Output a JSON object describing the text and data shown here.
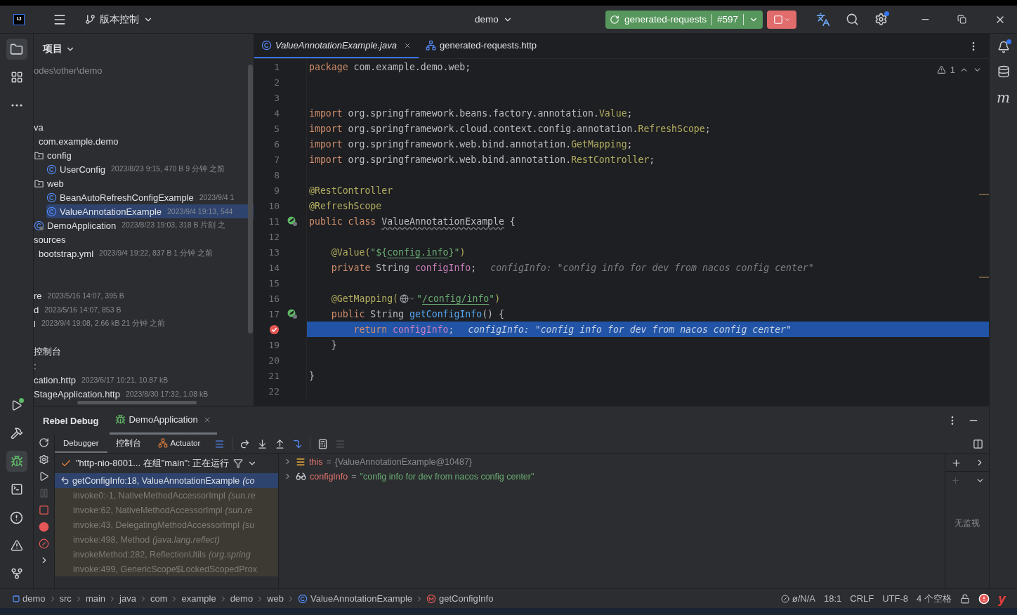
{
  "title_bar": {
    "logo": "IJ",
    "vcs": "版本控制",
    "project": "demo",
    "run_config": "generated-requests",
    "run_number": "#597"
  },
  "tool_strip": [
    {
      "kind": "folder",
      "selected": true
    },
    {
      "kind": "structure",
      "selected": false
    },
    {
      "kind": "more",
      "selected": false
    }
  ],
  "tool_strip_bottom": [
    {
      "kind": "run",
      "selected": false
    },
    {
      "kind": "build",
      "selected": false
    },
    {
      "kind": "debug",
      "selected": true
    },
    {
      "kind": "terminal",
      "selected": false
    },
    {
      "kind": "problems",
      "selected": false
    },
    {
      "kind": "warnings",
      "selected": false
    },
    {
      "kind": "git",
      "selected": false
    }
  ],
  "right_strip": {
    "maven_label": "m"
  },
  "project_panel": {
    "title": "项目",
    "path": "odes\\other\\demo",
    "sections": [
      {
        "nodes": [
          {
            "name": "va",
            "kind": "plain",
            "selected": false,
            "children": [
              {
                "name": "com.example.demo",
                "kind": "plain",
                "selected": false,
                "children": [
                  {
                    "name": "config",
                    "kind": "folder",
                    "selected": false,
                    "children": [
                      {
                        "name": "UserConfig",
                        "meta": "2023/8/23 9:15, 470 B 9 分钟 之前",
                        "kind": "class",
                        "selected": false
                      }
                    ]
                  },
                  {
                    "name": "web",
                    "kind": "folder",
                    "selected": false,
                    "children": [
                      {
                        "name": "BeanAutoRefreshConfigExample",
                        "meta": "2023/9/4 1",
                        "kind": "class",
                        "selected": false
                      },
                      {
                        "name": "ValueAnnotationExample",
                        "meta": "2023/9/4 19:13, 544",
                        "kind": "class",
                        "selected": true
                      }
                    ]
                  },
                  {
                    "name": "DemoApplication",
                    "meta": "2023/8/23 19:03, 318 B 片刻 之",
                    "kind": "app",
                    "selected": false
                  }
                ]
              }
            ]
          },
          {
            "name": "sources",
            "kind": "plain",
            "selected": false,
            "children": [
              {
                "name": "bootstrap.yml",
                "meta": "2023/9/4 19:22, 837 B 1 分钟 之前",
                "kind": "plain",
                "selected": false
              }
            ]
          }
        ]
      },
      {
        "nodes": [
          {
            "name": "re",
            "meta": "2023/5/16 14:07, 395 B",
            "kind": "plain",
            "selected": false
          },
          {
            "name": "d",
            "meta": "2023/5/16 14:07, 853 B",
            "kind": "plain",
            "selected": false
          },
          {
            "name": "l",
            "meta": "2023/9/4 19:08, 2.66 kB 21 分钟 之前",
            "kind": "plain",
            "selected": false
          }
        ]
      },
      {
        "nodes": [
          {
            "name": "控制台",
            "kind": "plain",
            "selected": false
          },
          {
            "name": ":",
            "kind": "plain",
            "selected": false
          },
          {
            "name": "cation.http",
            "meta": "2023/6/17 10:21, 10.87 kB",
            "kind": "plain",
            "selected": false
          },
          {
            "name": "StageApplication.http",
            "meta": "2023/8/30 17:32, 1.08 kB",
            "kind": "plain",
            "selected": false
          }
        ]
      }
    ]
  },
  "editor": {
    "tabs": [
      {
        "label": "ValueAnnotationExample.java",
        "kind": "class",
        "selected": true,
        "closable": true
      },
      {
        "label": "generated-requests.http",
        "kind": "http",
        "selected": false,
        "closable": false
      }
    ],
    "warning_count": "1",
    "lines": [
      {
        "number": "1",
        "bean": false,
        "breakpoint": false,
        "current": false,
        "segments": [
          {
            "kind": "keyword",
            "text": "package"
          },
          {
            "kind": "plain",
            "text": " com.example.demo.web;"
          }
        ]
      },
      {
        "number": "2",
        "bean": false,
        "breakpoint": false,
        "current": false
      },
      {
        "number": "3",
        "bean": false,
        "breakpoint": false,
        "current": false
      },
      {
        "number": "4",
        "bean": false,
        "breakpoint": false,
        "current": false,
        "segments": [
          {
            "kind": "keyword",
            "text": "import"
          },
          {
            "kind": "plain",
            "text": " org.springframework.beans.factory.annotation."
          },
          {
            "kind": "annotation",
            "text": "Value"
          },
          {
            "kind": "plain",
            "text": ";"
          }
        ]
      },
      {
        "number": "5",
        "bean": false,
        "breakpoint": false,
        "current": false,
        "segments": [
          {
            "kind": "keyword",
            "text": "import"
          },
          {
            "kind": "plain",
            "text": " org.springframework.cloud.context.config.annotation."
          },
          {
            "kind": "annotation",
            "text": "RefreshScope"
          },
          {
            "kind": "plain",
            "text": ";"
          }
        ]
      },
      {
        "number": "6",
        "bean": false,
        "breakpoint": false,
        "current": false,
        "segments": [
          {
            "kind": "keyword",
            "text": "import"
          },
          {
            "kind": "plain",
            "text": " org.springframework.web.bind.annotation."
          },
          {
            "kind": "annotation",
            "text": "GetMapping"
          },
          {
            "kind": "plain",
            "text": ";"
          }
        ]
      },
      {
        "number": "7",
        "bean": false,
        "breakpoint": false,
        "current": false,
        "segments": [
          {
            "kind": "keyword",
            "text": "import"
          },
          {
            "kind": "plain",
            "text": " org.springframework.web.bind.annotation."
          },
          {
            "kind": "annotation",
            "text": "RestController"
          },
          {
            "kind": "plain",
            "text": ";"
          }
        ]
      },
      {
        "number": "8",
        "bean": false,
        "breakpoint": false,
        "current": false
      },
      {
        "number": "9",
        "bean": false,
        "breakpoint": false,
        "current": false,
        "segments": [
          {
            "kind": "annotation",
            "text": "@RestController"
          }
        ]
      },
      {
        "number": "10",
        "bean": false,
        "breakpoint": false,
        "current": false,
        "segments": [
          {
            "kind": "annotation",
            "text": "@RefreshScope"
          }
        ]
      },
      {
        "number": "11",
        "bean": true,
        "breakpoint": false,
        "current": false,
        "segments": [
          {
            "kind": "keyword",
            "text": "public class "
          },
          {
            "kind": "wavy",
            "text": "ValueAnnotationExample"
          },
          {
            "kind": "plain",
            "text": " {"
          }
        ]
      },
      {
        "number": "12",
        "bean": false,
        "breakpoint": false,
        "current": false
      },
      {
        "number": "13",
        "bean": false,
        "breakpoint": false,
        "current": false,
        "segments": [
          {
            "kind": "annotation",
            "text": "    @Value("
          },
          {
            "kind": "string",
            "text": "\"${"
          },
          {
            "kind": "link",
            "text": "config.info"
          },
          {
            "kind": "string",
            "text": "}\""
          },
          {
            "kind": "annotation",
            "text": ")"
          }
        ]
      },
      {
        "number": "14",
        "bean": false,
        "breakpoint": false,
        "current": false,
        "segments": [
          {
            "kind": "keyword",
            "text": "    private"
          },
          {
            "kind": "plain",
            "text": " String "
          },
          {
            "kind": "field",
            "text": "configInfo"
          },
          {
            "kind": "plain",
            "text": ";"
          },
          {
            "kind": "hint",
            "text": "configInfo: \"config info for dev from nacos config center\""
          }
        ]
      },
      {
        "number": "15",
        "bean": false,
        "breakpoint": false,
        "current": false
      },
      {
        "number": "16",
        "bean": false,
        "breakpoint": false,
        "current": false,
        "segments": [
          {
            "kind": "annotation",
            "text": "    @GetMapping("
          },
          {
            "kind": "globe"
          },
          {
            "kind": "string",
            "text": "\""
          },
          {
            "kind": "link",
            "text": "/config/info"
          },
          {
            "kind": "string",
            "text": "\""
          },
          {
            "kind": "annotation",
            "text": ")"
          }
        ]
      },
      {
        "number": "17",
        "bean": true,
        "breakpoint": false,
        "current": false,
        "segments": [
          {
            "kind": "keyword",
            "text": "    public"
          },
          {
            "kind": "plain",
            "text": " String "
          },
          {
            "kind": "method",
            "text": "getConfigInfo"
          },
          {
            "kind": "plain",
            "text": "() {"
          }
        ]
      },
      {
        "bean": false,
        "breakpoint": true,
        "current": true,
        "segments": [
          {
            "kind": "keyword",
            "text": "        return "
          },
          {
            "kind": "field",
            "text": "configInfo"
          },
          {
            "kind": "plain",
            "text": ";"
          },
          {
            "kind": "hint",
            "text": "configInfo: \"config info for dev from nacos config center\""
          }
        ]
      },
      {
        "number": "19",
        "bean": false,
        "breakpoint": false,
        "current": false,
        "segments": [
          {
            "kind": "plain",
            "text": "    }"
          }
        ]
      },
      {
        "number": "20",
        "bean": false,
        "breakpoint": false,
        "current": false
      },
      {
        "number": "21",
        "bean": false,
        "breakpoint": false,
        "current": false,
        "segments": [
          {
            "kind": "plain",
            "text": "}"
          }
        ]
      },
      {
        "number": "22",
        "bean": false,
        "breakpoint": false,
        "current": false
      }
    ]
  },
  "debug_panel": {
    "title": "Rebel Debug",
    "session_tab": {
      "label": "DemoApplication",
      "selected": true
    },
    "tabs": [
      {
        "label": "Debugger",
        "kind": "plain",
        "selected": true
      },
      {
        "label": "控制台",
        "kind": "plain",
        "selected": false
      },
      {
        "label": "Actuator",
        "kind": "actuator",
        "selected": false
      }
    ],
    "thread": "\"http-nio-8001... 在组\"main\": 正在运行",
    "frames": [
      {
        "method": "getConfigInfo:18, ValueAnnotationExample",
        "package": "(co",
        "library": false,
        "selected": true
      },
      {
        "method": "invoke0:-1, NativeMethodAccessorImpl",
        "package": "(sun.re",
        "library": true,
        "selected": false
      },
      {
        "method": "invoke:62, NativeMethodAccessorImpl",
        "package": "(sun.re",
        "library": true,
        "selected": false
      },
      {
        "method": "invoke:43, DelegatingMethodAccessorImpl",
        "package": "(su",
        "library": true,
        "selected": false
      },
      {
        "method": "invoke:498, Method",
        "package": "(java.lang.reflect)",
        "library": true,
        "selected": false
      },
      {
        "method": "invokeMethod:282, ReflectionUtils",
        "package": "(org.spring",
        "library": true,
        "selected": false
      },
      {
        "method": "invoke:499, GenericScope$LockedScopedProx",
        "library": true,
        "selected": false
      }
    ],
    "variables": [
      {
        "kind": "object",
        "name": "this",
        "sign": "=",
        "value": "{ValueAnnotationExample@10487}"
      },
      {
        "kind": "watch",
        "name": "configInfo",
        "sign": "=",
        "value": "\"config info for dev from nacos config center\""
      }
    ],
    "watches_empty": "无监视"
  },
  "status_bar": {
    "breadcrumbs": [
      {
        "kind": "module",
        "text": "demo"
      },
      {
        "kind": "plain",
        "text": "src"
      },
      {
        "kind": "plain",
        "text": "main"
      },
      {
        "kind": "plain",
        "text": "java"
      },
      {
        "kind": "plain",
        "text": "com"
      },
      {
        "kind": "plain",
        "text": "example"
      },
      {
        "kind": "plain",
        "text": "demo"
      },
      {
        "kind": "plain",
        "text": "web"
      },
      {
        "kind": "class",
        "text": "ValueAnnotationExample"
      },
      {
        "kind": "method",
        "text": "getConfigInfo"
      }
    ],
    "items": [
      {
        "kind": "vcs",
        "text": "ø/N/A"
      },
      {
        "kind": "plain",
        "text": "18:1"
      },
      {
        "kind": "plain",
        "text": "CRLF"
      },
      {
        "kind": "plain",
        "text": "UTF-8"
      },
      {
        "kind": "plain",
        "text": "4 个空格"
      }
    ],
    "plugin_logo": "y"
  }
}
